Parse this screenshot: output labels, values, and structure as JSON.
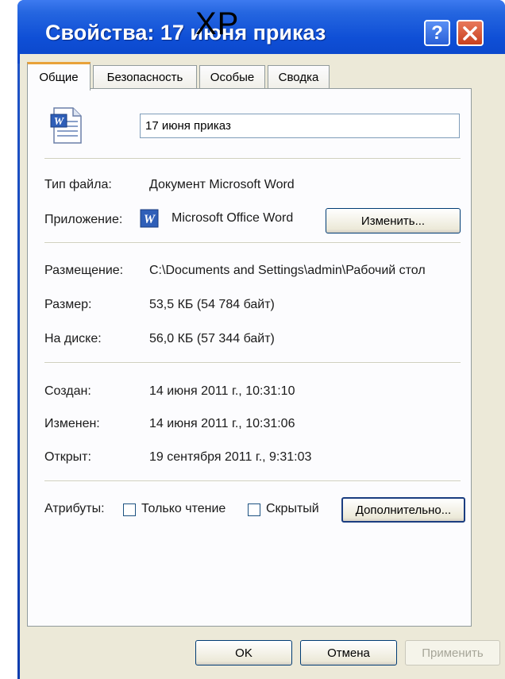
{
  "window": {
    "title": "Свойства: 17 июня приказ",
    "overlay_text": "XP"
  },
  "tabs": [
    {
      "label": "Общие"
    },
    {
      "label": "Безопасность"
    },
    {
      "label": "Особые"
    },
    {
      "label": "Сводка"
    }
  ],
  "file": {
    "name": "17 июня приказ"
  },
  "info": {
    "type_label": "Тип файла:",
    "type_value": "Документ Microsoft Word",
    "app_label": "Приложение:",
    "app_value": "Microsoft Office Word",
    "change_button": "Изменить...",
    "location_label": "Размещение:",
    "location_value": "C:\\Documents and Settings\\admin\\Рабочий стол",
    "size_label": "Размер:",
    "size_value": "53,5 КБ (54 784 байт)",
    "disk_label": "На диске:",
    "disk_value": "56,0 КБ (57 344 байт)",
    "created_label": "Создан:",
    "created_value": "14 июня 2011 г., 10:31:10",
    "modified_label": "Изменен:",
    "modified_value": "14 июня 2011 г., 10:31:06",
    "opened_label": "Открыт:",
    "opened_value": "19 сентября 2011 г., 9:31:03"
  },
  "attributes": {
    "label": "Атрибуты:",
    "readonly": "Только чтение",
    "hidden": "Скрытый",
    "advanced_button": "Дополнительно..."
  },
  "buttons": {
    "ok": "OK",
    "cancel": "Отмена",
    "apply": "Применить"
  }
}
